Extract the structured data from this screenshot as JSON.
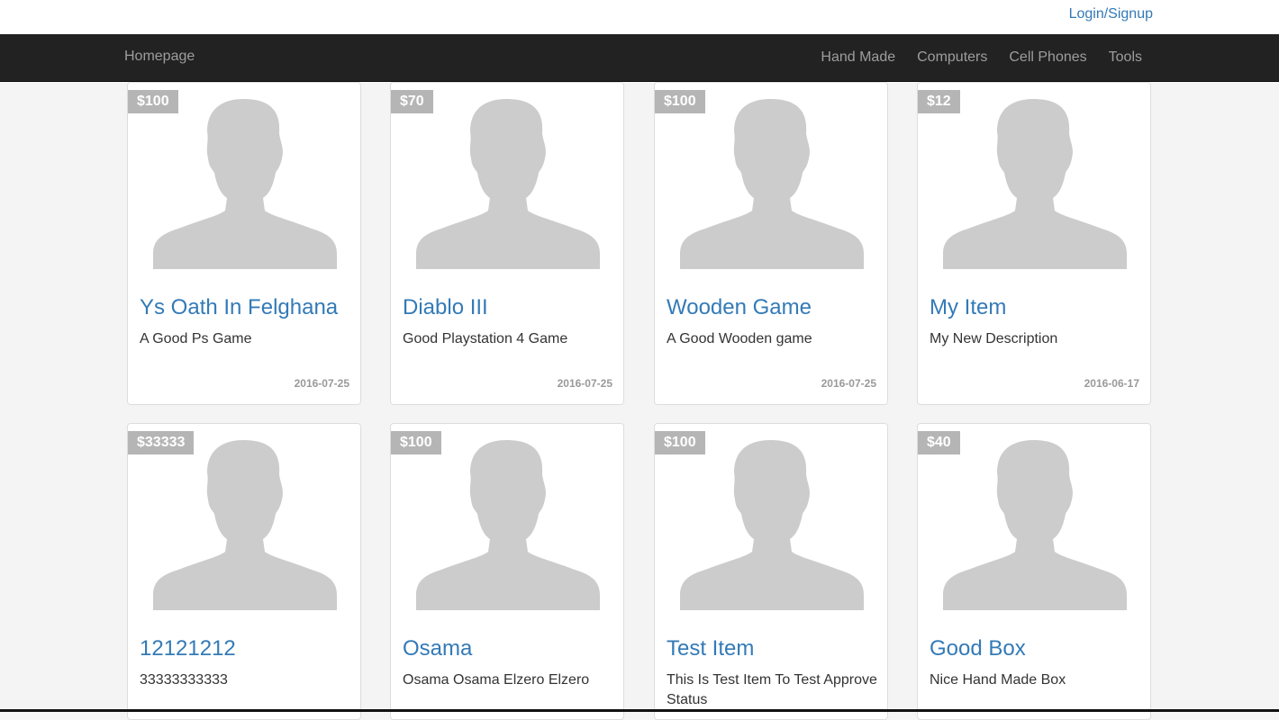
{
  "header": {
    "login_label": "Login/Signup"
  },
  "navbar": {
    "brand": "Homepage",
    "links": [
      "Hand Made",
      "Computers",
      "Cell Phones",
      "Tools"
    ]
  },
  "items": [
    {
      "price": "$100",
      "title": "Ys Oath In Felghana",
      "description": "A Good Ps Game",
      "date": "2016-07-25"
    },
    {
      "price": "$70",
      "title": "Diablo III",
      "description": "Good Playstation 4 Game",
      "date": "2016-07-25"
    },
    {
      "price": "$100",
      "title": "Wooden Game",
      "description": "A Good Wooden game",
      "date": "2016-07-25"
    },
    {
      "price": "$12",
      "title": "My Item",
      "description": "My New Description",
      "date": "2016-06-17"
    },
    {
      "price": "$33333",
      "title": "12121212",
      "description": "33333333333",
      "date": ""
    },
    {
      "price": "$100",
      "title": "Osama",
      "description": "Osama Osama Elzero Elzero",
      "date": ""
    },
    {
      "price": "$100",
      "title": "Test Item",
      "description": "This Is Test Item To Test Approve Status",
      "date": ""
    },
    {
      "price": "$40",
      "title": "Good Box",
      "description": "Nice Hand Made Box",
      "date": ""
    }
  ],
  "colors": {
    "navbar_bg": "#222222",
    "link_blue": "#337ab7",
    "price_badge": "#b5b5b5",
    "placeholder_avatar": "#cccccc"
  },
  "icons": {
    "avatar": "person-silhouette-placeholder"
  }
}
